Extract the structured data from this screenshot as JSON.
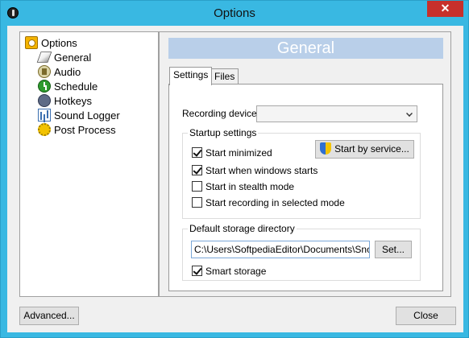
{
  "window": {
    "title": "Options",
    "close_glyph": "✕"
  },
  "tree": {
    "items": [
      {
        "label": "Options",
        "icon": "options-icon"
      },
      {
        "label": "General",
        "icon": "general-icon"
      },
      {
        "label": "Audio",
        "icon": "audio-icon"
      },
      {
        "label": "Schedule",
        "icon": "schedule-icon"
      },
      {
        "label": "Hotkeys",
        "icon": "hotkeys-icon"
      },
      {
        "label": "Sound Logger",
        "icon": "sound-logger-icon"
      },
      {
        "label": "Post Process",
        "icon": "post-process-icon"
      }
    ]
  },
  "section": {
    "header": "General"
  },
  "tabs": [
    {
      "label": "Settings",
      "active": true
    },
    {
      "label": "Files",
      "active": false
    }
  ],
  "settings": {
    "recording_device_label": "Recording device",
    "recording_device_value": "",
    "startup_group_title": "Startup settings",
    "start_minimized": {
      "label": "Start minimized",
      "checked": true
    },
    "start_when_windows_starts": {
      "label": "Start when windows starts",
      "checked": true
    },
    "start_in_stealth_mode": {
      "label": "Start in stealth mode",
      "checked": false
    },
    "start_recording_selected": {
      "label": "Start recording in selected mode",
      "checked": false
    },
    "start_by_service_label": "Start by service...",
    "storage_group_title": "Default storage directory",
    "storage_path": "C:\\Users\\SoftpediaEditor\\Documents\\Snoop",
    "set_button_label": "Set...",
    "smart_storage": {
      "label": "Smart storage",
      "checked": true
    }
  },
  "footer": {
    "advanced_label": "Advanced...",
    "close_label": "Close"
  },
  "colors": {
    "window_frame": "#39b8e2",
    "close_button": "#c7302b",
    "header_band": "#b9cfe9"
  }
}
